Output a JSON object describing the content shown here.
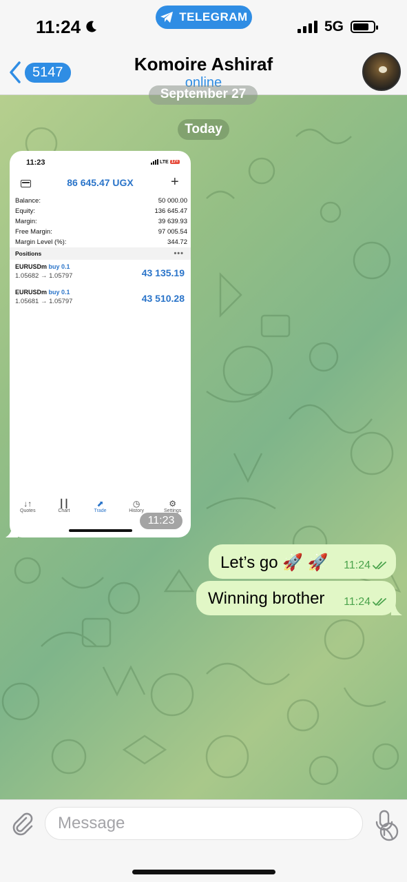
{
  "status_bar": {
    "time": "11:24",
    "network": "5G",
    "banner": "TELEGRAM"
  },
  "header": {
    "back_count": "5147",
    "title": "Komoire Ashiraf",
    "subtitle": "online"
  },
  "chat": {
    "date_prev": "September 27",
    "date_today": "Today",
    "image_message": {
      "time": "11:23",
      "screenshot": {
        "status_time": "11:23",
        "status_network": "LTE",
        "status_battery": "17+",
        "balance_title": "86 645.47 UGX",
        "rows": [
          {
            "label": "Balance:",
            "value": "50 000.00"
          },
          {
            "label": "Equity:",
            "value": "136 645.47"
          },
          {
            "label": "Margin:",
            "value": "39 639.93"
          },
          {
            "label": "Free Margin:",
            "value": "97 005.54"
          },
          {
            "label": "Margin Level (%):",
            "value": "344.72"
          }
        ],
        "positions_header": "Positions",
        "positions": [
          {
            "symbol": "EURUSDm",
            "side": "buy 0.1",
            "prices": "1.05682 → 1.05797",
            "profit": "43 135.19"
          },
          {
            "symbol": "EURUSDm",
            "side": "buy 0.1",
            "prices": "1.05681 → 1.05797",
            "profit": "43 510.28"
          }
        ],
        "tabs": [
          "Quotes",
          "Chart",
          "Trade",
          "History",
          "Settings"
        ]
      }
    },
    "outgoing": [
      {
        "text": "Let’s go 🚀 🚀",
        "time": "11:24"
      },
      {
        "text": "Winning brother",
        "time": "11:24"
      }
    ]
  },
  "input": {
    "placeholder": "Message"
  },
  "colors": {
    "accent": "#2f8de4",
    "bubble_out": "#e1f7c6",
    "check": "#4ba34c"
  }
}
